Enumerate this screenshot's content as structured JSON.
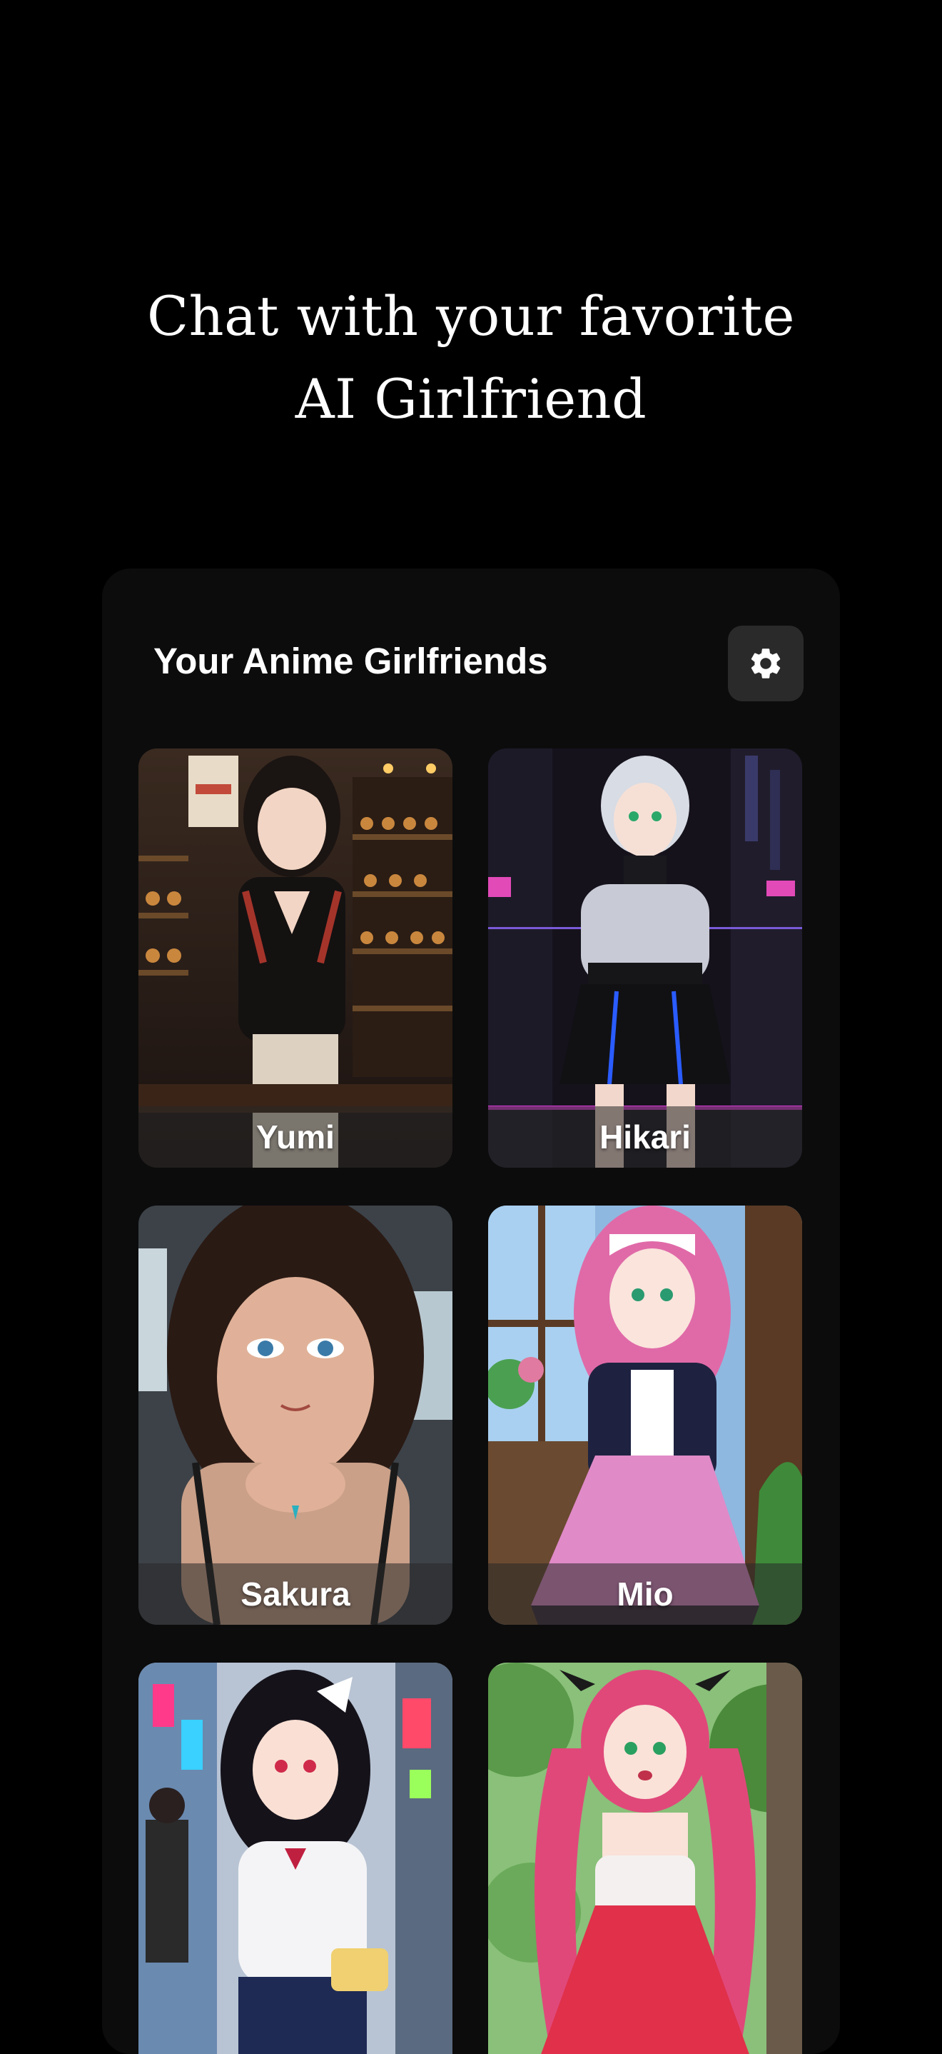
{
  "hero": {
    "line1": "Chat with your favorite",
    "line2": "AI Girlfriend"
  },
  "panel": {
    "title": "Your Anime Girlfriends",
    "settings_icon": "gear-icon"
  },
  "characters": [
    {
      "name": "Yumi"
    },
    {
      "name": "Hikari"
    },
    {
      "name": "Sakura"
    },
    {
      "name": "Mio"
    },
    {
      "name": "",
      "visible_name": false
    },
    {
      "name": "",
      "visible_name": false
    }
  ],
  "colors": {
    "background": "#000000",
    "panel": "#0c0c0c",
    "settings_button": "#2a2a2a",
    "text": "#ffffff"
  }
}
